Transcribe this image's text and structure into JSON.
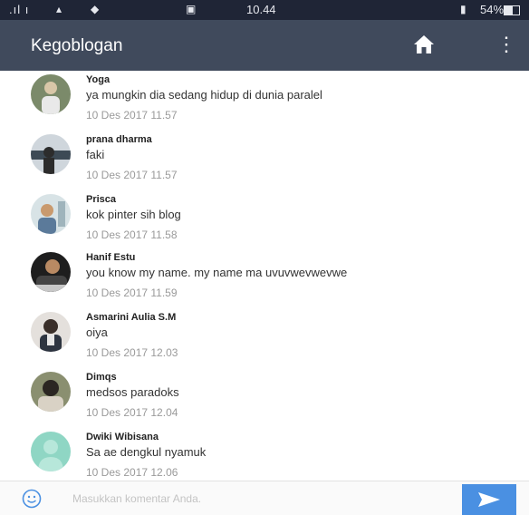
{
  "status_bar": {
    "signal": ".ıl ı",
    "time": "10.44",
    "battery": "54%"
  },
  "app_bar": {
    "title": "Kegoblogan",
    "home_icon": "home-icon",
    "more_icon": "more-vert-icon"
  },
  "comments": [
    {
      "name": "Yoga",
      "text": "ya mungkin dia sedang hidup di dunia paralel",
      "date": "10 Des 2017 11.57"
    },
    {
      "name": "prana dharma",
      "text": "faki",
      "date": "10 Des 2017 11.57"
    },
    {
      "name": "Prisca",
      "text": "kok pinter sih blog",
      "date": "10 Des 2017 11.58"
    },
    {
      "name": "Hanif Estu",
      "text": "you know my name. my name ma uvuvwevwevwe",
      "date": "10 Des 2017 11.59"
    },
    {
      "name": "Asmarini Aulia S.M",
      "text": "oiya",
      "date": "10 Des 2017 12.03"
    },
    {
      "name": "Dimqs",
      "text": "medsos paradoks",
      "date": "10 Des 2017 12.04"
    },
    {
      "name": "Dwiki Wibisana",
      "text": "Sa ae dengkul nyamuk",
      "date": "10 Des 2017 12.06"
    }
  ],
  "input": {
    "placeholder": "Masukkan komentar Anda.",
    "value": ""
  },
  "colors": {
    "app_bar": "#404a5c",
    "status_bar": "#1f2536",
    "send_button": "#4a90e2"
  }
}
